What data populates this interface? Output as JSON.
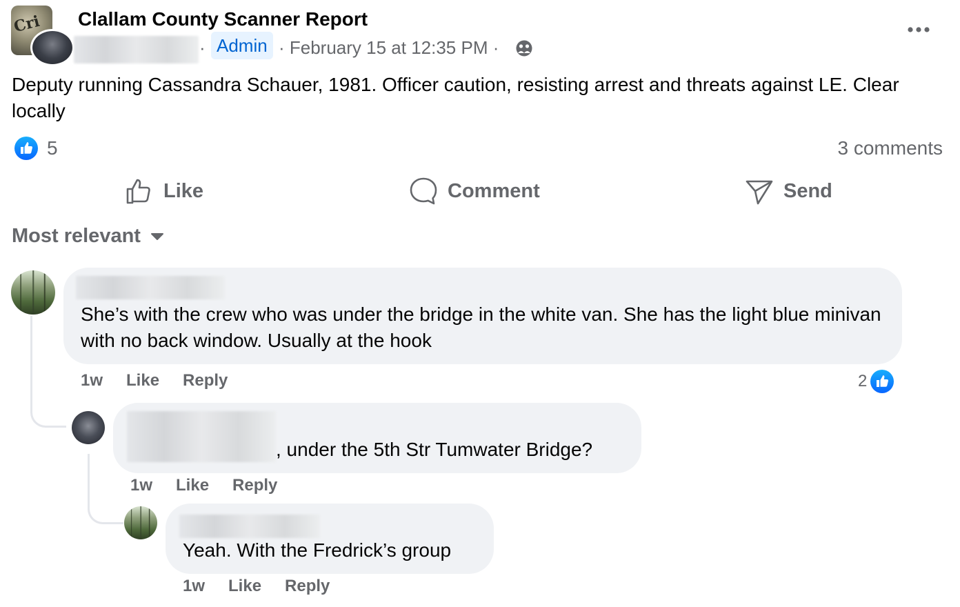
{
  "post": {
    "group_name": "Clallam County Scanner Report",
    "group_avatar_text": "Cri",
    "author_badge": "Admin",
    "separator": "·",
    "date": "· February 15 at 12:35 PM ·",
    "privacy_icon": "friends-icon",
    "more_icon": "more-horizontal-icon",
    "text": "Deputy running Cassandra Schauer, 1981. Officer caution,  resisting arrest and threats against LE. Clear locally",
    "reaction_count": "5",
    "comment_count": "3 comments"
  },
  "actions": {
    "like": "Like",
    "comment": "Comment",
    "send": "Send"
  },
  "sort": {
    "label": "Most relevant"
  },
  "comments": [
    {
      "text": "She’s with the crew who was under the bridge in the white van. She has the light blue minivan with no back window. Usually at the hook",
      "time": "1w",
      "like": "Like",
      "reply": "Reply",
      "reactions": "2"
    },
    {
      "text": ", under the 5th Str Tumwater Bridge?",
      "time": "1w",
      "like": "Like",
      "reply": "Reply"
    },
    {
      "text": "Yeah. With the Fredrick’s group",
      "time": "1w",
      "like": "Like",
      "reply": "Reply"
    }
  ],
  "colors": {
    "accent": "#0866ff",
    "secondary_text": "#65676b",
    "bubble": "#f0f2f5",
    "admin_bg": "#e7f3ff"
  }
}
